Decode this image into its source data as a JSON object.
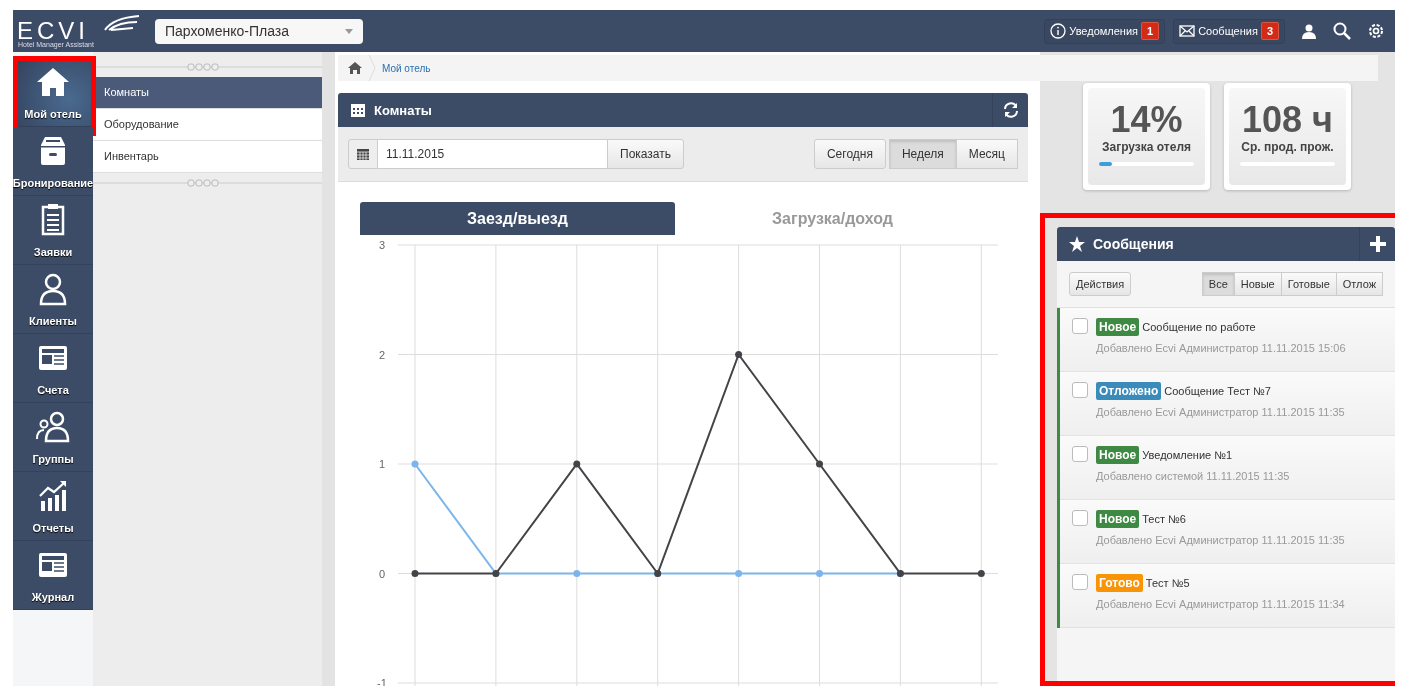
{
  "topbar": {
    "logo": "ECVI",
    "logo_subtitle": "Hotel Manager Assistant",
    "hotel_select": "Пархоменко-Плаза",
    "notifications": {
      "label": "Уведомления",
      "count": "1"
    },
    "messages": {
      "label": "Сообщения",
      "count": "3"
    }
  },
  "nav": [
    {
      "label": "Мой отель",
      "selected": true,
      "highlighted": true
    },
    {
      "label": "Бронирование",
      "selected": false,
      "highlighted": false
    },
    {
      "label": "Заявки",
      "selected": false,
      "highlighted": false
    },
    {
      "label": "Клиенты",
      "selected": false,
      "highlighted": false
    },
    {
      "label": "Счета",
      "selected": false,
      "highlighted": false
    },
    {
      "label": "Группы",
      "selected": false,
      "highlighted": false
    },
    {
      "label": "Отчеты",
      "selected": false,
      "highlighted": false
    },
    {
      "label": "Журнал",
      "selected": false,
      "highlighted": false
    }
  ],
  "submenu": [
    {
      "label": "Комнаты",
      "selected": true
    },
    {
      "label": "Оборудование",
      "selected": false
    },
    {
      "label": "Инвентарь",
      "selected": false
    }
  ],
  "breadcrumb": "Мой отель",
  "rooms_panel": {
    "title": "Комнаты",
    "date": "11.11.2015",
    "show_button": "Показать",
    "periods": [
      {
        "label": "Сегодня",
        "selected": false
      },
      {
        "label": "Неделя",
        "selected": true
      },
      {
        "label": "Месяц",
        "selected": false
      }
    ],
    "chart_tabs": [
      {
        "label": "Заезд/выезд",
        "selected": true
      },
      {
        "label": "Загрузка/доход",
        "selected": false
      }
    ],
    "chart_data": {
      "type": "line",
      "ylim": [
        -1,
        3
      ],
      "yticks": [
        3,
        2,
        1,
        0,
        -1
      ],
      "grid": true,
      "series": [
        {
          "color": "#7cb5ec",
          "marker": "circle",
          "values": [
            1,
            0,
            0,
            0,
            0,
            0,
            0,
            null
          ]
        },
        {
          "color": "#434348",
          "marker": "circle",
          "values": [
            0,
            0,
            1,
            0,
            2,
            1,
            0,
            0
          ]
        }
      ]
    }
  },
  "stats": [
    {
      "value": "14%",
      "label": "Загрузка отеля",
      "level": 0.14
    },
    {
      "value": "108 ч",
      "label": "Ср. прод. прож.",
      "level": 0
    }
  ],
  "messages_panel": {
    "title": "Сообщения",
    "highlighted": true,
    "actions_button": "Действия",
    "filters": [
      {
        "label": "Все",
        "selected": true
      },
      {
        "label": "Новые",
        "selected": false
      },
      {
        "label": "Готовые",
        "selected": false
      },
      {
        "label": "Отлож",
        "selected": false
      }
    ],
    "items": [
      {
        "color": "#3e8a44",
        "badge": "Новое",
        "title": "Сообщение по работе",
        "meta": "Добавлено Ecvi Администратор 11.11.2015 15:06",
        "checked": false
      },
      {
        "color": "#3b8bba",
        "badge": "Отложено",
        "title": "Сообщение Тест №7",
        "meta": "Добавлено Ecvi Администратор 11.11.2015 11:35",
        "checked": false
      },
      {
        "color": "#3e8a44",
        "badge": "Новое",
        "title": "Уведомление №1",
        "meta": "Добавлено системой 11.11.2015 11:35",
        "checked": false
      },
      {
        "color": "#3e8a44",
        "badge": "Новое",
        "title": "Тест №6",
        "meta": "Добавлено Ecvi Администратор 11.11.2015 11:35",
        "checked": false
      },
      {
        "color": "#f89406",
        "badge": "Готово",
        "title": "Тест №5",
        "meta": "Добавлено Ecvi Администратор 11.11.2015 11:34",
        "checked": false
      }
    ]
  }
}
